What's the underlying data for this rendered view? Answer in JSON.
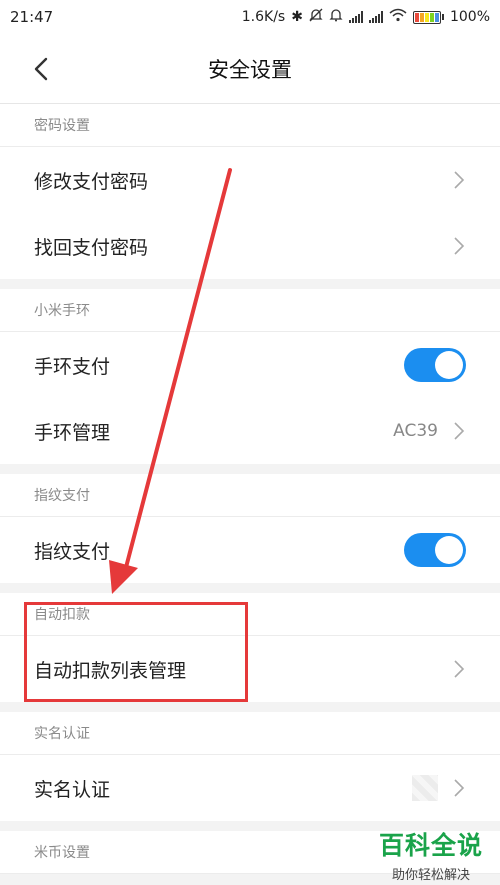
{
  "statusbar": {
    "time": "21:47",
    "net_speed": "1.6K/s",
    "battery": "100%"
  },
  "nav": {
    "title": "安全设置"
  },
  "sections": [
    {
      "header": "密码设置",
      "rows": [
        {
          "label": "修改支付密码"
        },
        {
          "label": "找回支付密码"
        }
      ]
    },
    {
      "header": "小米手环",
      "rows": [
        {
          "label": "手环支付",
          "toggle": true
        },
        {
          "label": "手环管理",
          "value": "AC39"
        }
      ]
    },
    {
      "header": "指纹支付",
      "rows": [
        {
          "label": "指纹支付",
          "toggle": true
        }
      ]
    },
    {
      "header": "自动扣款",
      "rows": [
        {
          "label": "自动扣款列表管理"
        }
      ]
    },
    {
      "header": "实名认证",
      "rows": [
        {
          "label": "实名认证"
        }
      ]
    },
    {
      "header": "米币设置"
    }
  ],
  "watermark": {
    "main": "百科全说",
    "sub": "助你轻松解决"
  },
  "colors": {
    "accent": "#1b8ef0",
    "annotation": "#e5393a",
    "watermark": "#1aa34a"
  }
}
